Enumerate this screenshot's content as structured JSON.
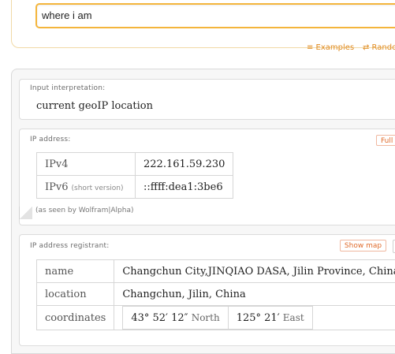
{
  "search": {
    "query": "where i am"
  },
  "links": {
    "examples": "≡ Examples",
    "random": "⇄ Random"
  },
  "pods": {
    "input": {
      "title": "Input interpretation:",
      "value": "current geoIP location"
    },
    "ip": {
      "title": "IP address:",
      "button": "Full",
      "rows": [
        {
          "label": "IPv4",
          "value": "222.161.59.230"
        },
        {
          "label": "IPv6",
          "note": "(short version)",
          "value": "::ffff:dea1:3be6"
        }
      ],
      "seen_by": "(as seen by Wolfram|Alpha)"
    },
    "registrant": {
      "title": "IP address registrant:",
      "button": "Show map",
      "rows": [
        {
          "label": "name",
          "value": "Changchun City,JINQIAO DASA, Jilin Province, China"
        },
        {
          "label": "location",
          "value": "Changchun, Jilin, China"
        }
      ],
      "coordinates": {
        "label": "coordinates",
        "lat": "43° 52′ 12″",
        "lat_dir": "North",
        "lon": "125° 21′",
        "lon_dir": "East"
      }
    }
  }
}
